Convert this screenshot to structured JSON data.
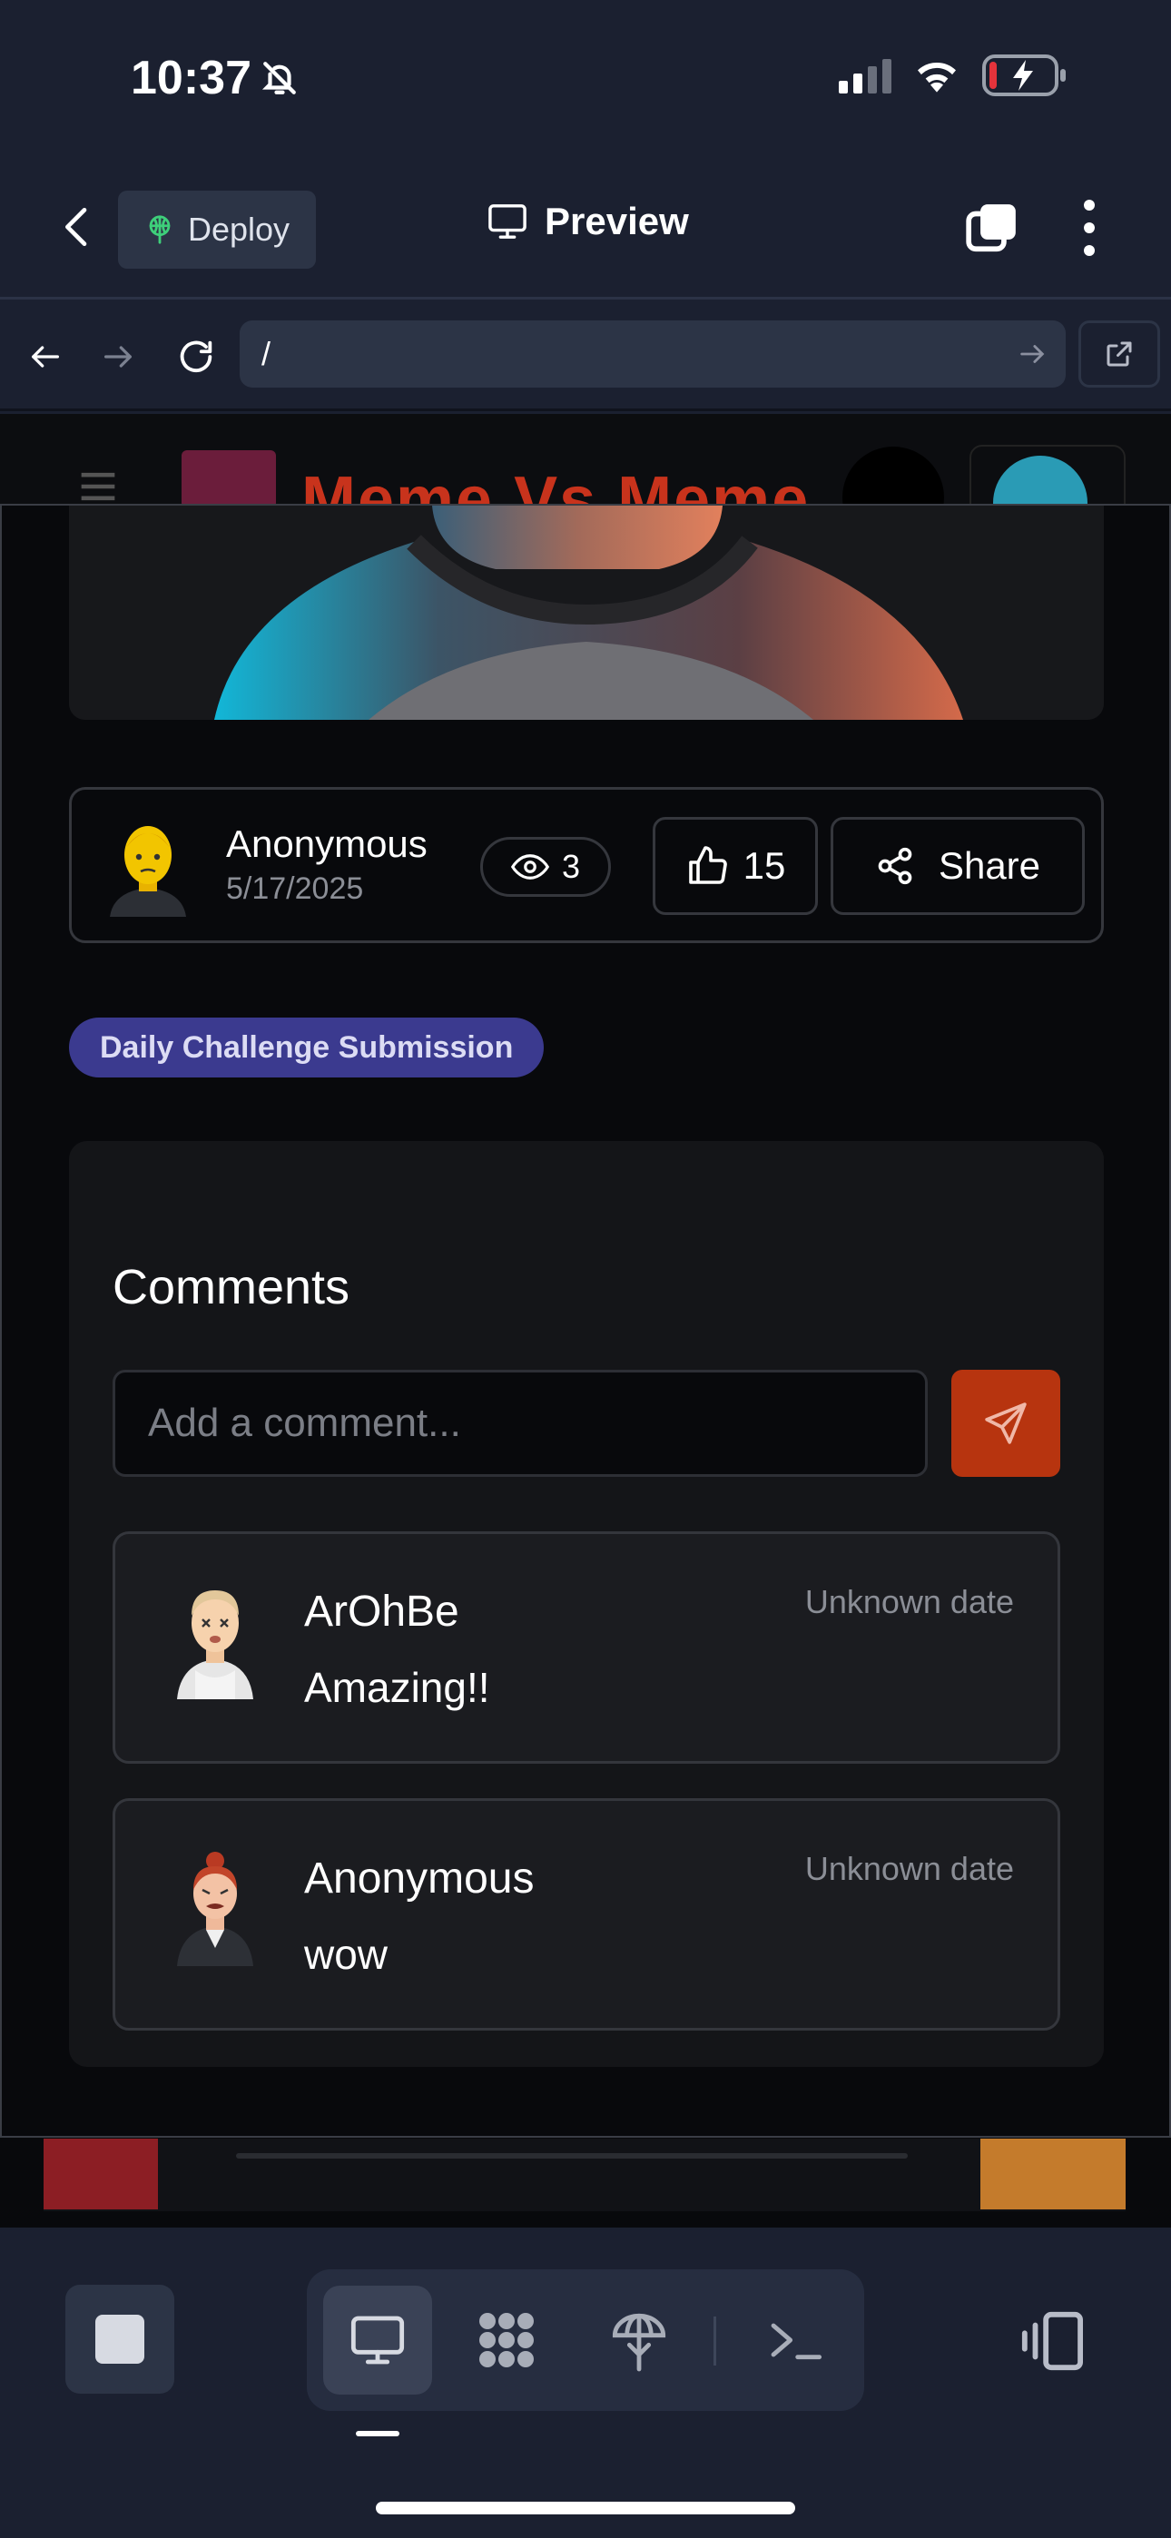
{
  "status_bar": {
    "time": "10:37",
    "icons": [
      "bell-slash-icon",
      "cellular-signal-icon",
      "wifi-icon",
      "battery-charging-icon"
    ]
  },
  "header": {
    "deploy_label": "Deploy",
    "preview_label": "Preview"
  },
  "url_bar": {
    "url": "/"
  },
  "page": {
    "site_title": "Meme Vs Meme",
    "post": {
      "author": "Anonymous",
      "date": "5/17/2025",
      "views": "3",
      "likes": "15",
      "share_label": "Share"
    },
    "badge": "Daily Challenge Submission",
    "comments": {
      "title": "Comments",
      "input_placeholder": "Add a comment...",
      "items": [
        {
          "author": "ArOhBe",
          "text": "Amazing!!",
          "date": "Unknown date"
        },
        {
          "author": "Anonymous",
          "text": "wow",
          "date": "Unknown date"
        }
      ]
    }
  },
  "colors": {
    "app_background": "#1b2030",
    "page_background": "#08090c",
    "badge": "#3b3a8f",
    "send_button": "#b7340f",
    "deploy_icon": "#3ecf7a"
  }
}
